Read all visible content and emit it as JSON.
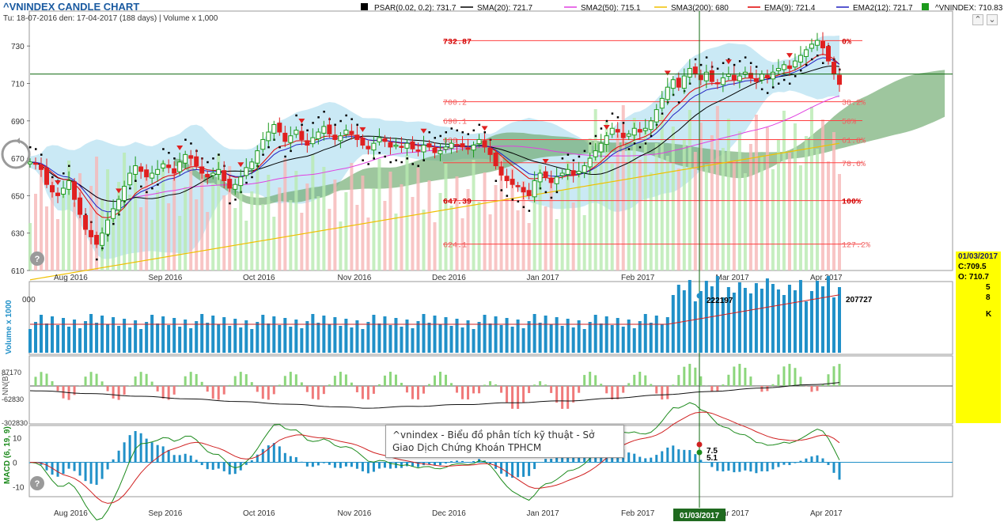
{
  "chart_data": {
    "type": "candlestick",
    "title": "^VNINDEX CANDLE CHART",
    "subtitle": "Tu: 18-07-2016 den: 17-04-2017 (188 days) | Volume x 1,000",
    "legend": [
      {
        "label": "PSAR(0.02, 0.2): 731.7",
        "color": "#000000",
        "kind": "square"
      },
      {
        "label": "SMA(20): 721.7",
        "color": "#000000",
        "kind": "line"
      },
      {
        "label": "SMA2(50): 715.1",
        "color": "#e040e0",
        "kind": "line"
      },
      {
        "label": "SMA3(200): 680",
        "color": "#f0c000",
        "kind": "line"
      },
      {
        "label": "EMA(9): 721.4",
        "color": "#e00000",
        "kind": "line"
      },
      {
        "label": "EMA2(12): 721.7",
        "color": "#2020c0",
        "kind": "line"
      },
      {
        "label": "^VNINDEX: 710.83",
        "color": "#1c9a1c",
        "kind": "square"
      }
    ],
    "months": [
      "Aug 2016",
      "Sep 2016",
      "Oct 2016",
      "Nov 2016",
      "Dec 2016",
      "Jan 2017",
      "Feb 2017",
      "Mar 2017",
      "Apr 2017"
    ],
    "price_axis": {
      "ticks": [
        "730",
        "710",
        "690",
        "670",
        "650",
        "630",
        "610"
      ],
      "ylim": [
        610,
        736
      ]
    },
    "closes": [
      668,
      667,
      664,
      656,
      652,
      650,
      654,
      658,
      648,
      640,
      632,
      628,
      624,
      630,
      637,
      643,
      648,
      655,
      662,
      666,
      663,
      660,
      662,
      664,
      667,
      665,
      662,
      668,
      672,
      670,
      666,
      662,
      660,
      662,
      664,
      658,
      654,
      656,
      660,
      665,
      668,
      674,
      680,
      684,
      688,
      684,
      679,
      682,
      685,
      680,
      677,
      681,
      684,
      687,
      683,
      680,
      682,
      685,
      683,
      680,
      677,
      675,
      678,
      681,
      679,
      676,
      677,
      676,
      678,
      675,
      674,
      677,
      676,
      673,
      674,
      676,
      678,
      677,
      676,
      675,
      677,
      680,
      676,
      672,
      666,
      661,
      658,
      656,
      655,
      652,
      650,
      658,
      662,
      660,
      657,
      660,
      662,
      664,
      661,
      663,
      666,
      670,
      674,
      678,
      682,
      686,
      684,
      681,
      683,
      686,
      684,
      686,
      690,
      696,
      702,
      708,
      712,
      708,
      714,
      718,
      715,
      712,
      716,
      711,
      710,
      713,
      715,
      712,
      714,
      716,
      713,
      711,
      715,
      713,
      716,
      718,
      720,
      718,
      722,
      725,
      728,
      731,
      733,
      729,
      722,
      715,
      709.5
    ],
    "markers": {
      "date": "01/03/2017",
      "close_label": "C:709.5",
      "open_label": "O: 710.7",
      "volume_label": "222197",
      "last_volume_label": "207727",
      "macd_label_1": "7.5",
      "macd_label_2": "5.1"
    },
    "fib_levels": [
      {
        "price": 732.87,
        "label": "732.87",
        "pct": "0%"
      },
      {
        "price": 700.2,
        "label": "700.2",
        "pct": "38.2%"
      },
      {
        "price": 690.1,
        "label": "690.1",
        "pct": "50%"
      },
      {
        "price": 680,
        "label": "680",
        "pct": "61.8%"
      },
      {
        "price": 667.6,
        "label": "",
        "pct": "78.6%"
      },
      {
        "price": 647.39,
        "label": "647.39",
        "pct": "100%"
      },
      {
        "price": 624.1,
        "label": "624.1",
        "pct": "127.2%"
      }
    ],
    "volume_axis": {
      "label": "Volume x 1000",
      "ticks": [
        "000"
      ]
    },
    "nn_axis": {
      "label": "NN(B)",
      "ticks": [
        "87170",
        "-62830",
        "-302830"
      ]
    },
    "macd_axis": {
      "label": "MACD (6, 19, 9)",
      "ticks": [
        "10",
        "0",
        "-10"
      ],
      "ylim": [
        -14,
        15
      ]
    }
  },
  "tooltip": {
    "line1": "^vnindex - Biểu đồ phân tích kỹ thuật - Sở",
    "line2": "Giao Dịch Chứng Khoán TPHCM"
  },
  "side_panel": {
    "date": "01/03/2017",
    "close": "C:709.5",
    "open": "O: 710.7",
    "v1": "5",
    "v2": "8",
    "v3": "K"
  },
  "colors": {
    "up": "#1c9a1c",
    "down": "#e02020",
    "cloud": "#b8e2f2",
    "kumo": "#6aa86a",
    "accent": "#ff0000"
  },
  "icons": {
    "nav_up": "chevron-up-icon",
    "nav_down": "chevron-down-icon",
    "help": "question-icon",
    "refresh": "circle-arrow-icon"
  }
}
